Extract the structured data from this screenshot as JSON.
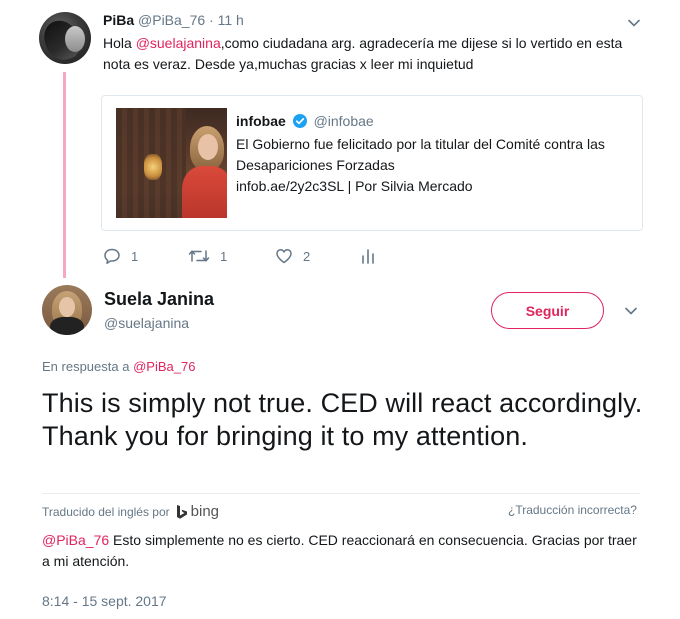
{
  "parent_tweet": {
    "author_name": "PiBa",
    "author_handle": "@PiBa_76",
    "separator": "·",
    "time": "11 h",
    "text_before_mention": "Hola ",
    "mention": "@suelajanina",
    "text_after_mention": ",como ciudadana arg. agradecería me dijese si lo vertido en esta nota es veraz. Desde ya,muchas gracias x leer mi inquietud",
    "card": {
      "source_name": "infobae",
      "source_handle": "@infobae",
      "description": "El Gobierno fue felicitado por la titular del Comité contra las Desapariciones Forzadas",
      "link_text": "infob.ae/2y2c3SL | Por Silvia Mercado"
    },
    "actions": {
      "reply_count": "1",
      "retweet_count": "1",
      "like_count": "2"
    }
  },
  "main_tweet": {
    "author_name": "Suela Janina",
    "author_handle": "@suelajanina",
    "follow_label": "Seguir",
    "reply_to_label": "En respuesta a",
    "reply_to_handle": "@PiBa_76",
    "text": "This is simply not true. CED will react accordingly. Thank you for bringing it to my attention.",
    "translated_by_label": "Traducido del inglés por",
    "translator": "bing",
    "bad_translation_label": "¿Traducción incorrecta?",
    "translation_mention": "@PiBa_76",
    "translation_text": " Esto simplemente no es cierto. CED reaccionará en consecuencia. Gracias por traer a mi atención.",
    "timestamp": "8:14 - 15 sept. 2017"
  },
  "colors": {
    "accent": "#e0245e",
    "thread_line": "#f4a6c6",
    "muted_text": "#657786",
    "verified_blue": "#1da1f2"
  },
  "icons": {
    "verified": "verified-badge-icon",
    "caret": "chevron-down-icon",
    "reply": "reply-icon",
    "retweet": "retweet-icon",
    "like": "heart-icon",
    "analytics": "analytics-icon",
    "bing": "bing-logo-icon"
  }
}
